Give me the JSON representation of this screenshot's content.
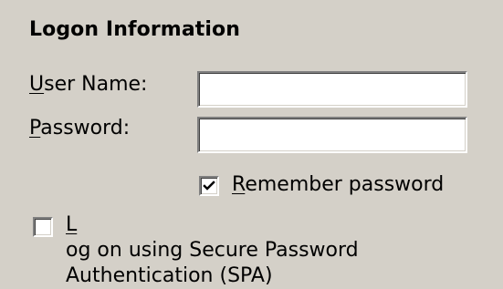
{
  "section": {
    "title": "Logon Information"
  },
  "fields": {
    "user_name": {
      "label_prefix": "",
      "label_mnemonic": "U",
      "label_suffix": "ser Name:",
      "value": ""
    },
    "password": {
      "label_prefix": "",
      "label_mnemonic": "P",
      "label_suffix": "assword:",
      "value": ""
    }
  },
  "options": {
    "remember_password": {
      "checked": true,
      "label_prefix": "",
      "label_mnemonic": "R",
      "label_suffix": "emember password"
    },
    "spa": {
      "checked": false,
      "line1_prefix": "",
      "line1_mnemonic": "L",
      "line1_suffix": "og on using Secure Password",
      "line2": "Authentication (SPA)"
    }
  },
  "colors": {
    "background": "#d4d0c8",
    "input_background": "#ffffff",
    "text": "#000000"
  }
}
